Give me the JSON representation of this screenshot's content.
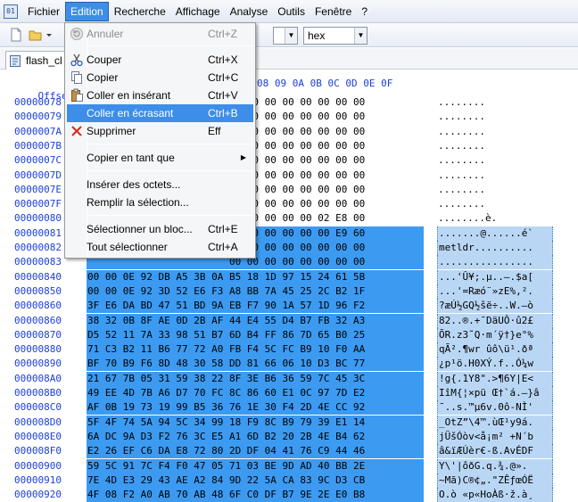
{
  "menubar": {
    "items": [
      "Fichier",
      "Edition",
      "Recherche",
      "Affichage",
      "Analyse",
      "Outils",
      "Fenêtre",
      "?"
    ],
    "active_index": 1
  },
  "toolbar": {
    "combo_right_value": "hex"
  },
  "tab": {
    "label": "flash_cl"
  },
  "hex": {
    "header_offset": "Offset (",
    "header_cols": "08 09 0A 0B 0C 0D 0E 0F",
    "rows": [
      {
        "offset": "00000078",
        "bytes": "                        00 00 00 00 00 00 00 00",
        "ascii": "........",
        "sel": false
      },
      {
        "offset": "00000079",
        "bytes": "                        00 00 00 00 00 00 00 00",
        "ascii": "........",
        "sel": false
      },
      {
        "offset": "0000007A",
        "bytes": "                        00 00 00 00 00 00 00 00",
        "ascii": "........",
        "sel": false
      },
      {
        "offset": "0000007B",
        "bytes": "                        00 00 00 00 00 00 00 00",
        "ascii": "........",
        "sel": false
      },
      {
        "offset": "0000007C",
        "bytes": "                        00 00 00 00 00 00 00 00",
        "ascii": "........",
        "sel": false
      },
      {
        "offset": "0000007D",
        "bytes": "                        00 00 00 00 00 00 00 00",
        "ascii": "........",
        "sel": false
      },
      {
        "offset": "0000007E",
        "bytes": "                        00 00 00 00 00 00 00 00",
        "ascii": "........",
        "sel": false
      },
      {
        "offset": "0000007F",
        "bytes": "                        00 00 00 00 00 00 00 00",
        "ascii": "........",
        "sel": false
      },
      {
        "offset": "00000080",
        "bytes": "                        00 00 00 00 00 02 E8 00",
        "ascii": "........è.",
        "sel": false
      },
      {
        "offset": "00000081",
        "bytes": "                        00 00 00 00 00 00 E9 60",
        "ascii": ".......@......é`",
        "sel": true
      },
      {
        "offset": "00000082",
        "bytes": "                        00 00 00 00 00 00 00 00",
        "ascii": "metldr..........",
        "sel": true
      },
      {
        "offset": "00000083",
        "bytes": "                        00 00 00 00 00 00 00 00",
        "ascii": "................",
        "sel": true
      },
      {
        "offset": "00000840",
        "bytes": "00 00 0E 92 DB A5 3B 0A B5 18 1D 97 15 24 61 5B",
        "ascii": "...'Û¥;.µ..—.$a[",
        "sel": true
      },
      {
        "offset": "00000850",
        "bytes": "00 00 0E 92 3D 52 E6 F3 A8 BB 7A 45 25 2C B2 1F",
        "ascii": "...'=Ræó¨»zE%,².",
        "sel": true
      },
      {
        "offset": "00000860",
        "bytes": "3F E6 DA BD 47 51 BD 9A EB F7 90 1A 57 1D 96 F2",
        "ascii": "?æÚ½GQ½šë÷..W.–ò",
        "sel": true
      },
      {
        "offset": "00000860",
        "bytes": "38 32 0B 8F AE 0D 2B AF 44 E4 55 D4 B7 FB 32 A3",
        "ascii": "82..®.+¯DäUÔ·û2£",
        "sel": true
      },
      {
        "offset": "00000870",
        "bytes": "D5 52 11 7A 33 98 51 B7 6D B4 FF 86 7D 65 B0 25",
        "ascii": "ÕR.z3˜Q·m´ÿ†}e°%",
        "sel": true
      },
      {
        "offset": "00000880",
        "bytes": "71 C3 B2 11 B6 77 72 A0 FB F4 5C FC B9 10 F0 AA",
        "ascii": "qÃ².¶wr ûô\\ü¹.ðª",
        "sel": true
      },
      {
        "offset": "00000890",
        "bytes": "BF 70 B9 F6 8D 48 30 58 DD 81 66 06 10 D3 BC 77",
        "ascii": "¿p¹ö.H0XÝ.f..Ó¼w",
        "sel": true
      },
      {
        "offset": "000008A0",
        "bytes": "21 67 7B 05 31 59 38 22 8F 3E B6 36 59 7C 45 3C",
        "ascii": "!g{.1Y8\".>¶6Y|E<",
        "sel": true
      },
      {
        "offset": "000008B0",
        "bytes": "49 EE 4D 7B A6 D7 70 FC 8C 86 60 E1 0C 97 7D E2",
        "ascii": "IîM{¦×pü Œ†`á.—}â",
        "sel": true
      },
      {
        "offset": "000008C0",
        "bytes": "AF 0B 19 73 19 99 B5 36 76 1E 30 F4 2D 4E CC 92",
        "ascii": "¯..s.™µ6v.0ô-NÌ'",
        "sel": true
      },
      {
        "offset": "000008D0",
        "bytes": "5F 4F 74 5A 94 5C 34 99 18 F9 8C B9 79 39 E1 14",
        "ascii": "_OtZ”\\4™.ùŒ¹y9á.",
        "sel": true
      },
      {
        "offset": "000008E0",
        "bytes": "6A DC 9A D3 F2 76 3C E5 A1 6D B2 20 2B 4E B4 62",
        "ascii": "jÜšÓòv<å¡m² +N´b",
        "sel": true
      },
      {
        "offset": "000008F0",
        "bytes": "E2 26 EF C6 DA E8 72 80 2D DF 04 41 76 C9 44 46",
        "ascii": "â&ïÆÚèr€-ß.AvÉDF",
        "sel": true
      },
      {
        "offset": "00000900",
        "bytes": "59 5C 91 7C F4 F0 47 05 71 03 BE 9D AD 40 BB 2E",
        "ascii": "Y\\'|ôðG.q.¾.­@».",
        "sel": true
      },
      {
        "offset": "00000910",
        "bytes": "7E 4D E3 29 43 AE A2 84 9D 22 5A CA 83 9C D3 CB",
        "ascii": "~Mã)C®¢„.\"ZÊƒœÓË",
        "sel": true
      },
      {
        "offset": "00000920",
        "bytes": "4F 08 F2 A0 AB 70 AB 48 6F C0 DF B7 9E 2E E0 B8",
        "ascii": "O.ò «p«HoÀß·ž.à¸",
        "sel": true
      }
    ]
  },
  "edit_menu": {
    "items": [
      {
        "label": "Annuler",
        "shortcut": "Ctrl+Z",
        "icon": "undo-icon",
        "disabled": true
      },
      {
        "label": "Couper",
        "shortcut": "Ctrl+X",
        "icon": "cut-icon"
      },
      {
        "label": "Copier",
        "shortcut": "Ctrl+C",
        "icon": "copy-icon"
      },
      {
        "label": "Coller en insérant",
        "shortcut": "Ctrl+V",
        "icon": "paste-icon"
      },
      {
        "label": "Coller en écrasant",
        "shortcut": "Ctrl+B",
        "highlighted": true
      },
      {
        "label": "Supprimer",
        "shortcut": "Eff",
        "icon": "delete-icon"
      },
      {
        "label": "Copier en tant que",
        "shortcut": "",
        "submenu": true
      },
      {
        "label": "Insérer des octets...",
        "shortcut": ""
      },
      {
        "label": "Remplir la sélection...",
        "shortcut": ""
      },
      {
        "label": "Sélectionner un bloc...",
        "shortcut": "Ctrl+E"
      },
      {
        "label": "Tout sélectionner",
        "shortcut": "Ctrl+A"
      }
    ]
  },
  "colors": {
    "accent": "#3d8ee8",
    "selection": "#3c9af1",
    "offset_blue": "#1b3fd8"
  }
}
